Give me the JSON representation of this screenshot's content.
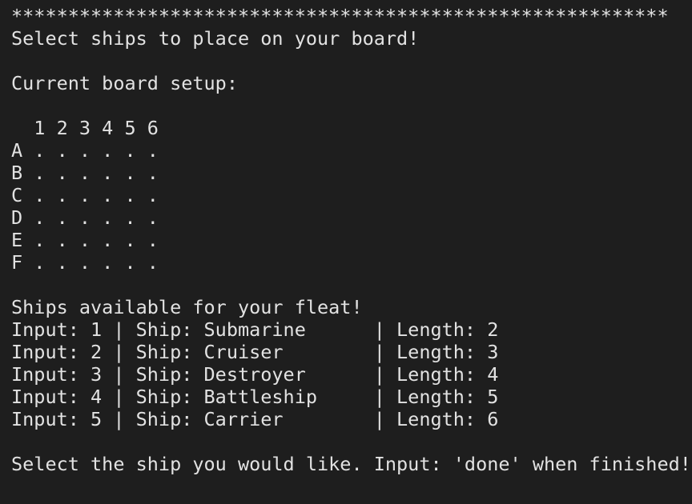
{
  "terminal": {
    "lines": [
      "**********************************************************",
      "Select ships to place on your board!",
      "",
      "Current board setup:",
      "",
      "  1 2 3 4 5 6",
      "A . . . . . .",
      "B . . . . . .",
      "C . . . . . .",
      "D . . . . . .",
      "E . . . . . .",
      "F . . . . . .",
      "",
      "Ships available for your fleat!",
      "Input: 1 | Ship: Submarine      | Length: 2",
      "Input: 2 | Ship: Cruiser        | Length: 3",
      "Input: 3 | Ship: Destroyer      | Length: 4",
      "Input: 4 | Ship: Battleship     | Length: 5",
      "Input: 5 | Ship: Carrier        | Length: 6",
      "",
      "Select the ship you would like. Input: 'done' when finished!"
    ]
  }
}
